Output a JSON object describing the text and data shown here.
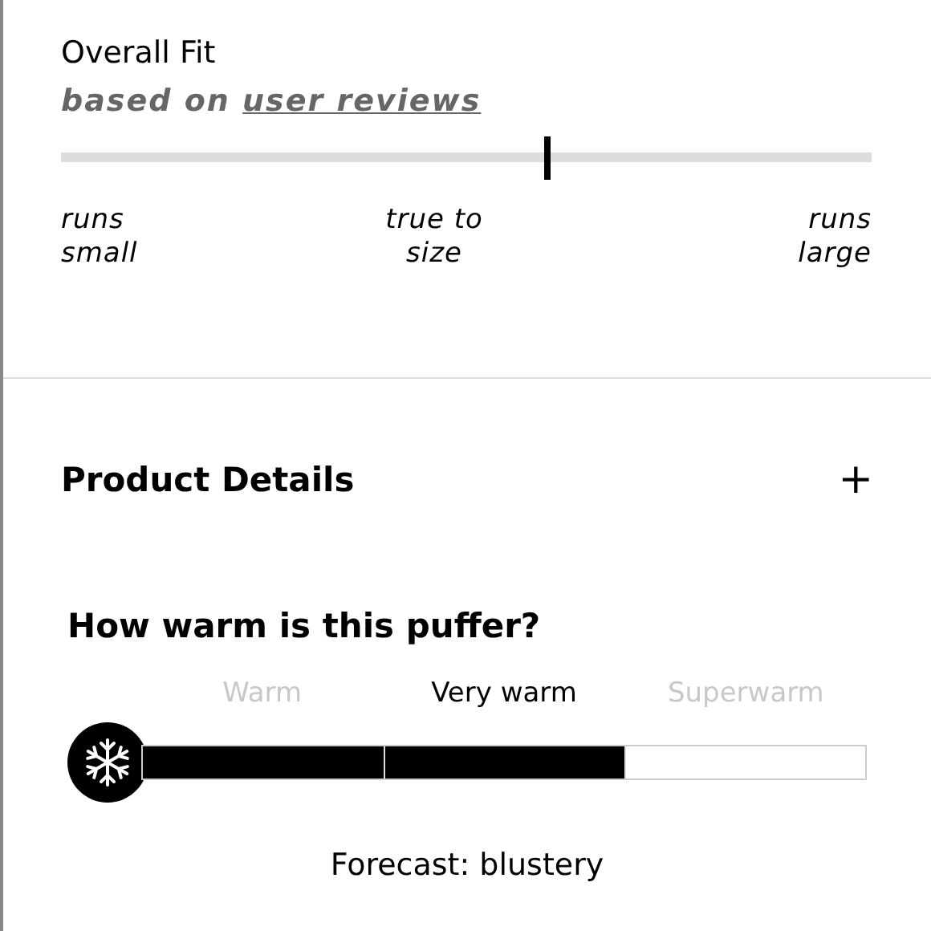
{
  "overall_fit": {
    "title": "Overall Fit",
    "subtitle_prefix": "based on",
    "subtitle_link": "user reviews",
    "level": 0.6,
    "scale_labels": [
      "runs small",
      "true to size",
      "runs large"
    ]
  },
  "product_details": {
    "title": "Product Details",
    "toggle": "+",
    "expanded": false
  },
  "warmth": {
    "title": "How warm is this puffer?",
    "level": 0.667,
    "options": [
      {
        "label": "Warm",
        "selected": false
      },
      {
        "label": "Very warm",
        "selected": true
      },
      {
        "label": "Superwarm",
        "selected": false
      }
    ],
    "forecast": "Forecast: blustery"
  }
}
